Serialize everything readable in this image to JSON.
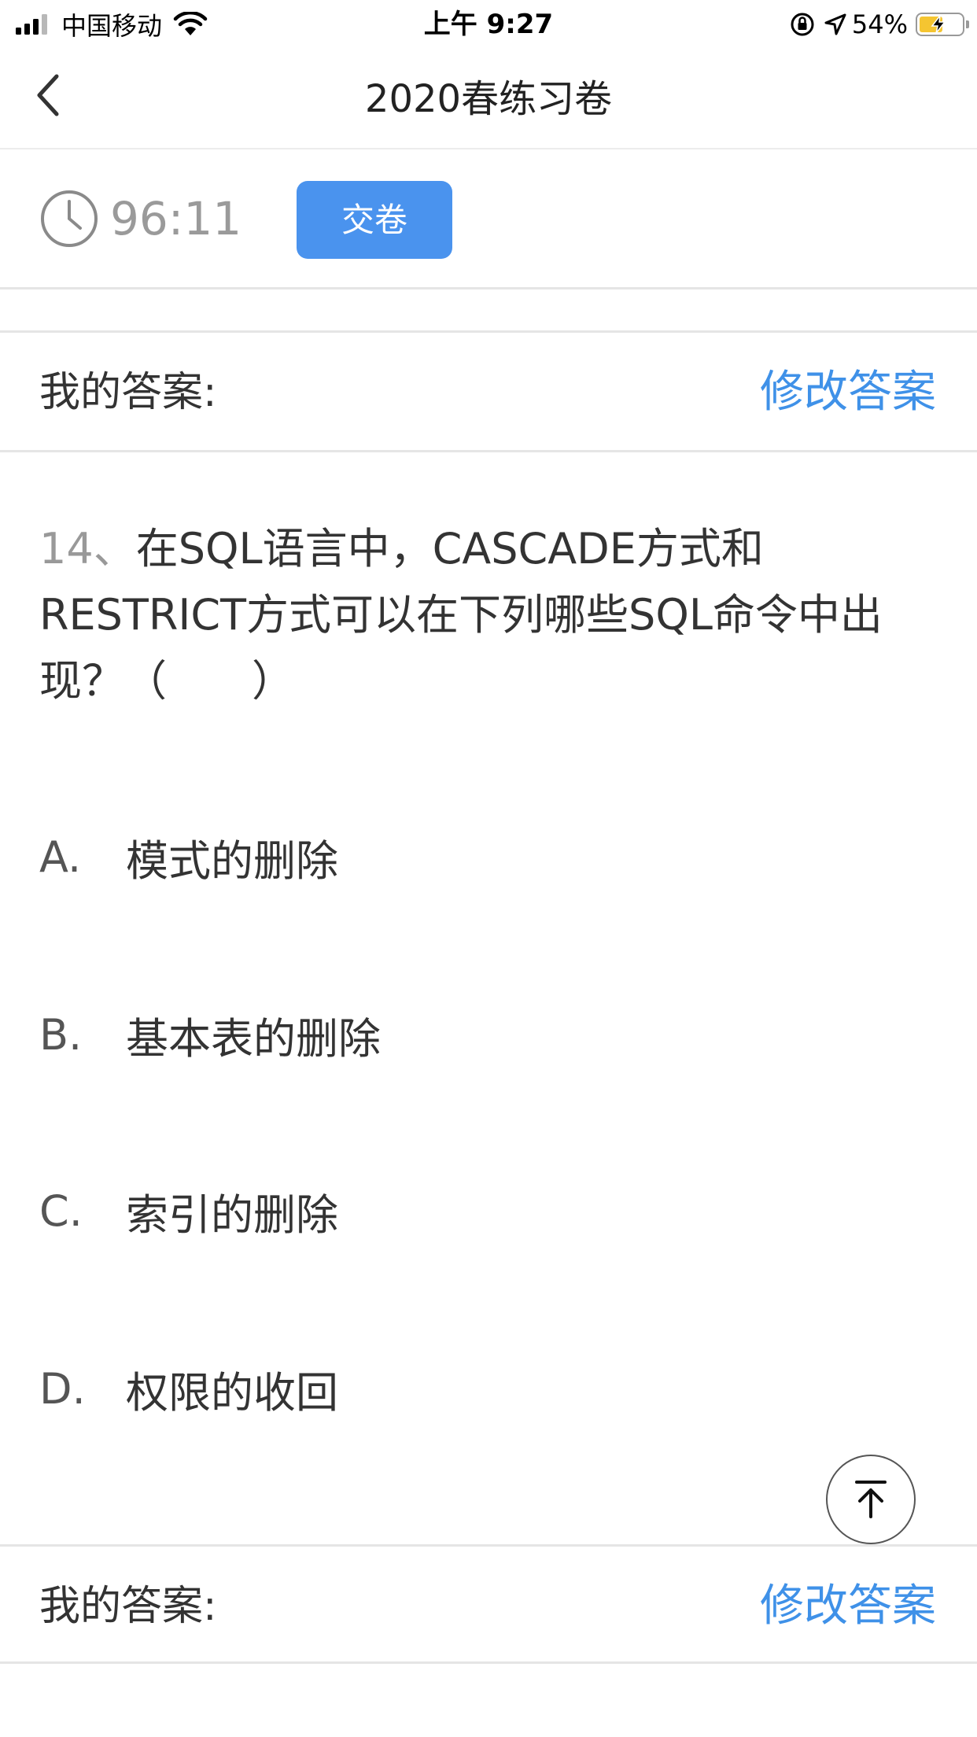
{
  "status_bar": {
    "carrier": "中国移动",
    "time": "上午 9:27",
    "battery_percent": "54%",
    "battery_level": 0.54
  },
  "nav": {
    "title": "2020春练习卷",
    "back_icon": "chevron-left-icon"
  },
  "exam": {
    "timer": "96:11",
    "submit_label": "交卷"
  },
  "answer_bar": {
    "label": "我的答案:",
    "edit_label": "修改答案"
  },
  "question": {
    "number": "14、",
    "text": "在SQL语言中，CASCADE方式和RESTRICT方式可以在下列哪些SQL命令中出现？（　　）",
    "options": [
      {
        "letter": "A.",
        "text": "模式的删除"
      },
      {
        "letter": "B.",
        "text": "基本表的删除"
      },
      {
        "letter": "C.",
        "text": "索引的删除"
      },
      {
        "letter": "D.",
        "text": "权限的收回"
      }
    ]
  },
  "colors": {
    "accent": "#4a93ee",
    "link": "#3f91e8",
    "battery": "#f5c531"
  }
}
